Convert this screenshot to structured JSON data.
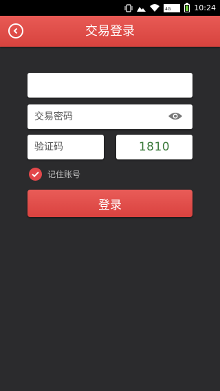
{
  "statusbar": {
    "time": "10:24",
    "network": "4G"
  },
  "header": {
    "title": "交易登录",
    "back_icon": "back-circle-icon"
  },
  "form": {
    "account": {
      "value": "",
      "placeholder": ""
    },
    "password": {
      "placeholder": "交易密码"
    },
    "captcha_input": {
      "placeholder": "验证码"
    },
    "captcha_code": "1810",
    "remember_label": "记住账号",
    "remember_checked": true,
    "login_label": "登录"
  },
  "colors": {
    "accent": "#e2474a",
    "header": "#e05a55",
    "background": "#2b2b2d",
    "captcha_text": "#3b7a3b"
  }
}
